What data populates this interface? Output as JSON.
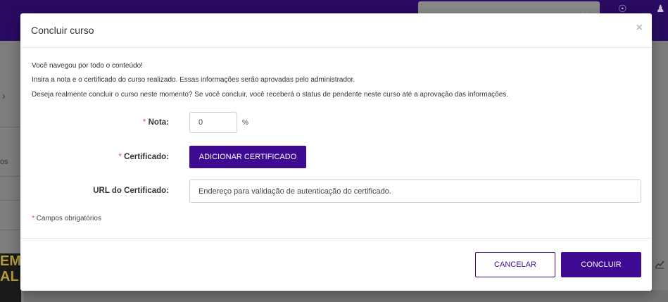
{
  "modal": {
    "title": "Concluir curso",
    "close_glyph": "×",
    "messages": [
      "Você navegou por todo o conteúdo!",
      "Insira a nota e o certificado do curso realizado. Essas informações serão aprovadas pelo administrador.",
      "Deseja realmente concluir o curso neste momento? Se você concluir, você receberá o status de pendente neste curso até a aprovação das informações."
    ],
    "fields": {
      "nota": {
        "label": "Nota:",
        "value": "0",
        "unit": "%",
        "required": true
      },
      "certificado": {
        "label": "Certificado:",
        "button_label": "ADICIONAR CERTIFICADO",
        "required": true
      },
      "url": {
        "label": "URL do Certificado:",
        "placeholder": "Endereço para validação de autenticação do certificado."
      }
    },
    "required_marker": "*",
    "required_note": "Campos obrigatórios",
    "footer": {
      "cancel_label": "CANCELAR",
      "submit_label": "CONCLUIR"
    }
  },
  "background": {
    "poster_text": "EM\nAL",
    "partial_text": "os"
  },
  "colors": {
    "primary": "#3d0a91",
    "header_bg": "#2a0b63",
    "required": "#d9534f"
  },
  "icons": [
    "close-icon",
    "location-icon",
    "users-icon",
    "chevron-right-icon",
    "chart-icon"
  ]
}
